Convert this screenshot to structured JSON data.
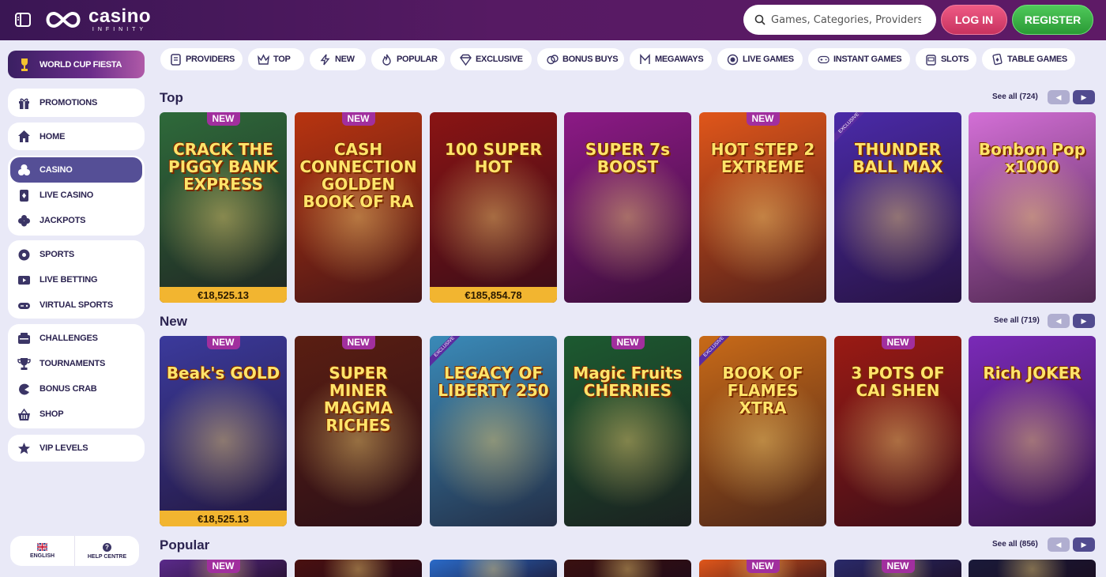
{
  "brand": {
    "name": "casino",
    "tagline": "INFINITY"
  },
  "search": {
    "placeholder": "Games, Categories, Providers"
  },
  "auth": {
    "login": "LOG IN",
    "register": "REGISTER"
  },
  "promo": {
    "label": "WORLD CUP FIESTA"
  },
  "sidebar": {
    "promotions": "PROMOTIONS",
    "home": "HOME",
    "casino": "CASINO",
    "live_casino": "LIVE CASINO",
    "jackpots": "JACKPOTS",
    "sports": "SPORTS",
    "live_betting": "LIVE BETTING",
    "virtual_sports": "VIRTUAL SPORTS",
    "challenges": "CHALLENGES",
    "tournaments": "TOURNAMENTS",
    "bonus_crab": "BONUS CRAB",
    "shop": "SHOP",
    "vip_levels": "VIP LEVELS"
  },
  "footer": {
    "language": "ENGLISH",
    "help": "HELP CENTRE"
  },
  "categories": {
    "providers": "PROVIDERS",
    "top": "TOP",
    "new": "NEW",
    "popular": "POPULAR",
    "exclusive": "EXCLUSIVE",
    "bonus_buys": "BONUS BUYS",
    "megaways": "MEGAWAYS",
    "live_games": "LIVE GAMES",
    "instant_games": "INSTANT GAMES",
    "slots": "SLOTS",
    "table_games": "TABLE GAMES"
  },
  "badges": {
    "new": "NEW",
    "exclusive": "EXCLUSIVE"
  },
  "sections": {
    "top": {
      "title": "Top",
      "see_all": "See all (724)",
      "games": [
        {
          "name": "CRACK THE PIGGY BANK EXPRESS",
          "jackpot": "€18,525.13",
          "color": "#2e6a3a"
        },
        {
          "name": "CASH CONNECTION GOLDEN BOOK OF RA",
          "color": "#b83410"
        },
        {
          "name": "100 SUPER HOT",
          "jackpot": "€185,854.78",
          "color": "#8a1414"
        },
        {
          "name": "SUPER 7s BOOST",
          "color": "#8c1a86"
        },
        {
          "name": "HOT STEP 2 EXTREME",
          "color": "#e0561a"
        },
        {
          "name": "THUNDER BALL MAX",
          "color": "#4a2aa8"
        },
        {
          "name": "Bonbon Pop x1000",
          "color": "#d36fd6"
        }
      ]
    },
    "new": {
      "title": "New",
      "see_all": "See all (719)",
      "games": [
        {
          "name": "Beak's GOLD",
          "jackpot": "€18,525.13",
          "color": "#3b3a9c"
        },
        {
          "name": "SUPER MINER MAGMA RICHES",
          "color": "#5a1e12"
        },
        {
          "name": "LEGACY OF LIBERTY 250",
          "color": "#3a8ab8"
        },
        {
          "name": "Magic Fruits CHERRIES",
          "color": "#1c5a30"
        },
        {
          "name": "BOOK OF FLAMES XTRA",
          "color": "#c86a18"
        },
        {
          "name": "3 POTS OF CAI SHEN",
          "color": "#9a1a14"
        },
        {
          "name": "Rich JOKER",
          "color": "#7a2ab8"
        }
      ]
    },
    "popular": {
      "title": "Popular",
      "see_all": "See all (856)",
      "colors": [
        "#5a2a8a",
        "#4a1010",
        "#2a6ac8",
        "#3a1010",
        "#e0561a",
        "#2a2a6a",
        "#1a1a3a"
      ]
    }
  }
}
